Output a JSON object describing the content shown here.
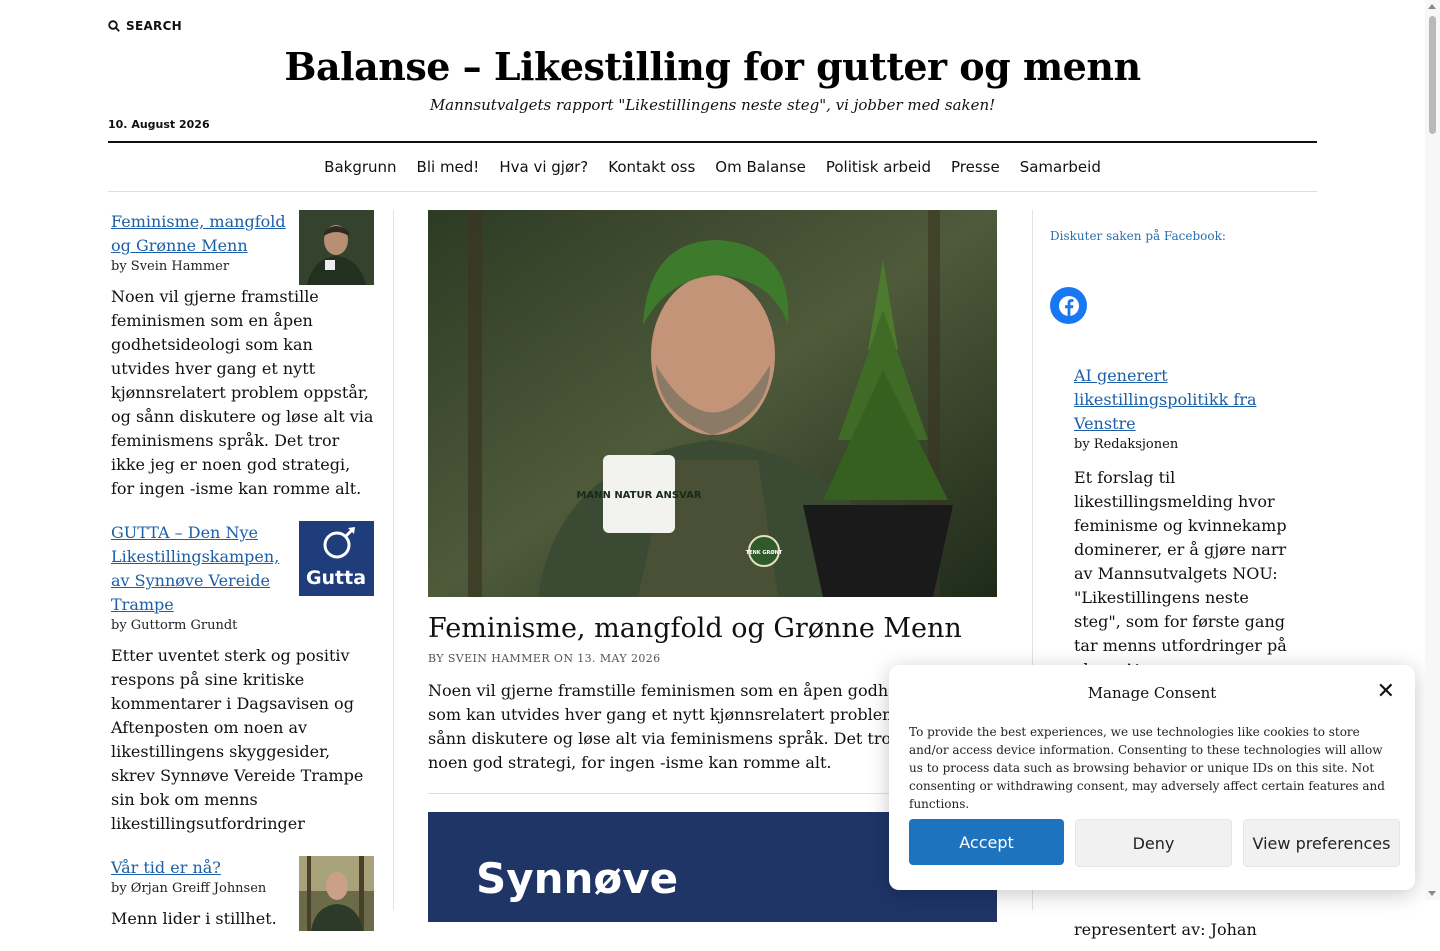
{
  "header": {
    "search_label": "SEARCH",
    "site_title": "Balanse – Likestilling for gutter og menn",
    "tagline": "Mannsutvalgets rapport \"Likestillingens neste steg\", vi jobber med saken!",
    "date": "10. August 2026"
  },
  "nav": {
    "items": [
      "Bakgrunn",
      "Bli med!",
      "Hva vi gjør?",
      "Kontakt oss",
      "Om Balanse",
      "Politisk arbeid",
      "Presse",
      "Samarbeid"
    ]
  },
  "left_sidebar": {
    "posts": [
      {
        "title": "Feminisme, mangfold og Grønne Menn",
        "byline": "by Svein Hammer",
        "excerpt": "Noen vil gjerne framstille feminismen som en åpen godhetsideologi som kan utvides hver gang et nytt kjønnsrelatert problem oppstår, og sånn diskutere og løse alt via feminismens språk. Det tror ikke jeg er noen god strategi, for ingen -isme kan romme alt."
      },
      {
        "title": "GUTTA – Den Nye Likestillingskampen, av Synnøve Vereide Trampe",
        "byline": "by Guttorm Grundt",
        "excerpt": "Etter uventet sterk og positiv respons på sine kritiske kommentarer i Dagsavisen og Aftenposten om noen av likestillingens skyggesider, skrev Synnøve Vereide Trampe sin bok om menns likestillingsutfordringer",
        "thumb_text": "Gutta"
      },
      {
        "title": "Vår tid er nå?",
        "byline": "by Ørjan Greiff Johnsen",
        "excerpt": "Menn lider i stillhet."
      }
    ]
  },
  "main": {
    "hero_mug_text": "MANN NATUR ANSVAR",
    "hero_badge_text": "TENK GRØNT",
    "title": "Feminisme, mangfold og Grønne Menn",
    "meta": "BY SVEIN HAMMER ON 13. MAY 2026",
    "excerpt": "Noen vil gjerne framstille feminismen som en åpen godhetsideologi som kan utvides hver gang et nytt kjønnsrelatert problem oppstår, og sånn diskutere og løse alt via feminismens språk. Det tror ikke jeg er noen god strategi, for ingen -isme kan romme alt.",
    "second_banner_text": "Synnøve"
  },
  "right_sidebar": {
    "facebook_label": "Diskuter saken på Facebook:",
    "post": {
      "title": "AI generert likestillingspolitikk fra Venstre",
      "byline": "by Redaksjonen",
      "excerpt": "Et forslag til likestillingsmelding hvor feminisme og kvinnekamp dominerer, er å gjøre narr av Mannsutvalgets NOU: \"Likestillingens neste steg\", som for første gang tar menns utfordringer på alvor. At",
      "tail": "representert av: Johan"
    }
  },
  "consent": {
    "title": "Manage Consent",
    "body": "To provide the best experiences, we use technologies like cookies to store and/or access device information. Consenting to these technologies will allow us to process data such as browsing behavior or unique IDs on this site. Not consenting or withdrawing consent, may adversely affect certain features and functions.",
    "accept": "Accept",
    "deny": "Deny",
    "preferences": "View preferences"
  },
  "colors": {
    "link": "#1a5fa8",
    "accept_button": "#1e73be",
    "facebook": "#1877f2",
    "gutta_thumb": "#1e3d7a",
    "banner": "#1e3566"
  }
}
